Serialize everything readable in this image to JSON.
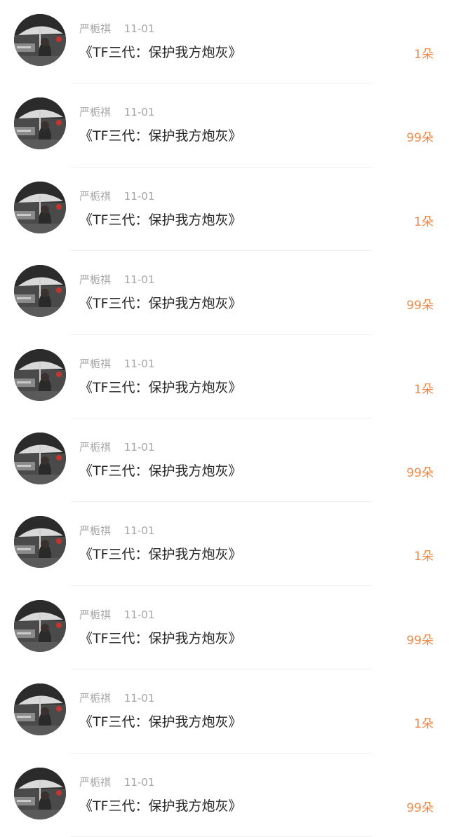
{
  "accent_color": "#ef8a4a",
  "items": [
    {
      "user": "严栀祺",
      "date": "11-01",
      "title": "《TF三代：保护我方炮灰》",
      "count": "1朵"
    },
    {
      "user": "严栀祺",
      "date": "11-01",
      "title": "《TF三代：保护我方炮灰》",
      "count": "99朵"
    },
    {
      "user": "严栀祺",
      "date": "11-01",
      "title": "《TF三代：保护我方炮灰》",
      "count": "1朵"
    },
    {
      "user": "严栀祺",
      "date": "11-01",
      "title": "《TF三代：保护我方炮灰》",
      "count": "99朵"
    },
    {
      "user": "严栀祺",
      "date": "11-01",
      "title": "《TF三代：保护我方炮灰》",
      "count": "1朵"
    },
    {
      "user": "严栀祺",
      "date": "11-01",
      "title": "《TF三代：保护我方炮灰》",
      "count": "99朵"
    },
    {
      "user": "严栀祺",
      "date": "11-01",
      "title": "《TF三代：保护我方炮灰》",
      "count": "1朵"
    },
    {
      "user": "严栀祺",
      "date": "11-01",
      "title": "《TF三代：保护我方炮灰》",
      "count": "99朵"
    },
    {
      "user": "严栀祺",
      "date": "11-01",
      "title": "《TF三代：保护我方炮灰》",
      "count": "1朵"
    },
    {
      "user": "严栀祺",
      "date": "11-01",
      "title": "《TF三代：保护我方炮灰》",
      "count": "99朵"
    }
  ]
}
